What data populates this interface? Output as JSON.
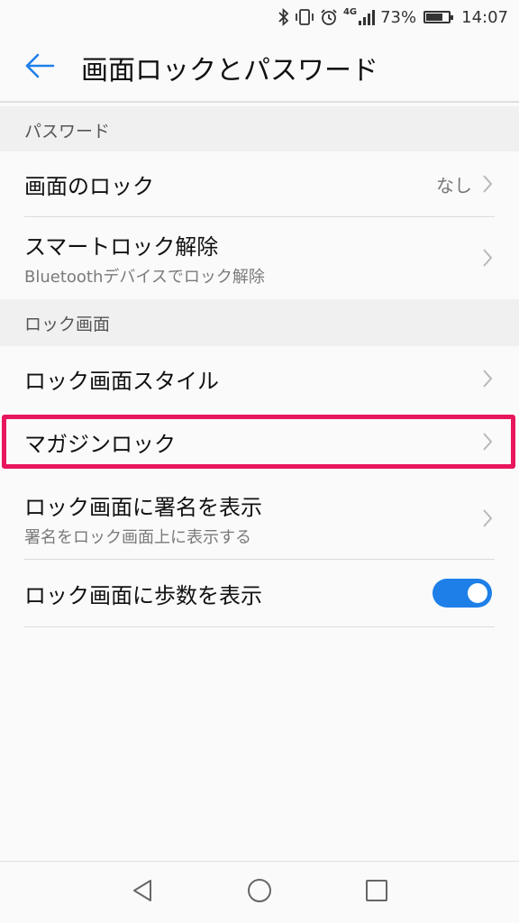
{
  "status_bar": {
    "network": "4G",
    "battery_percent": "73%",
    "battery_level": 0.73,
    "time": "14:07",
    "icons": [
      "bluetooth-icon",
      "vibrate-icon",
      "alarm-icon",
      "signal-icon",
      "battery-icon"
    ]
  },
  "app_bar": {
    "title": "画面ロックとパスワード",
    "back_icon": "arrow-left-icon"
  },
  "sections": {
    "password": {
      "header": "パスワード",
      "items": [
        {
          "title": "画面のロック",
          "value": "なし"
        },
        {
          "title": "スマートロック解除",
          "subtitle": "Bluetoothデバイスでロック解除"
        }
      ]
    },
    "lock_screen": {
      "header": "ロック画面",
      "items": [
        {
          "title": "ロック画面スタイル"
        },
        {
          "title": "マガジンロック",
          "highlighted": true
        },
        {
          "title": "ロック画面に署名を表示",
          "subtitle": "署名をロック画面上に表示する"
        },
        {
          "title": "ロック画面に歩数を表示",
          "toggle": true
        }
      ]
    }
  },
  "colors": {
    "accent": "#1e7fe8",
    "highlight": "#e8175d"
  },
  "nav_bar": {
    "icons": [
      "back-triangle-icon",
      "home-circle-icon",
      "recents-square-icon"
    ]
  }
}
